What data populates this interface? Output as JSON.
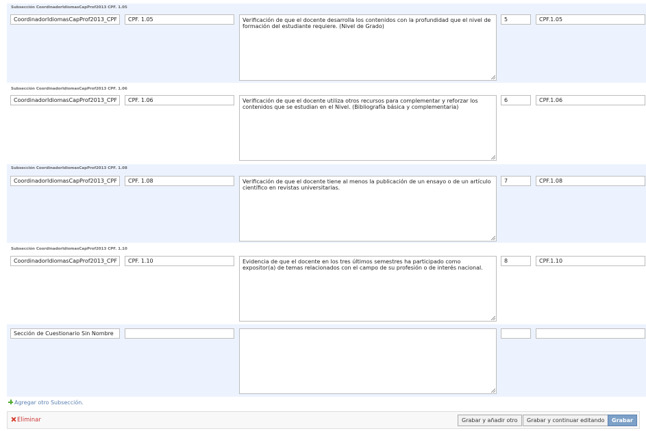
{
  "sections": [
    {
      "title": "Subsección CoordinadorIdiomasCapProf2013  CPF. 1.05",
      "name": "CoordinadorIdiomasCapProf2013_CPF",
      "code": "CPF. 1.05",
      "description": "Verificación de que el docente desarrolla los contenidos con la profundidad que el nivel de formación del estudiante requiere. (Nivel de Grado)",
      "order": "5",
      "identifier": "CPF.1.05"
    },
    {
      "title": "Subsección CoordinadorIdiomasCapProf2013  CPF. 1.06",
      "name": "CoordinadorIdiomasCapProf2013_CPF",
      "code": "CPF. 1.06",
      "description": "Verificación de que el docente utiliza otros recursos para complementar y reforzar los contenidos que se estudian en el Nivel. (Bibliografía básica y complementaria)",
      "order": "6",
      "identifier": "CPF.1.06"
    },
    {
      "title": "Subsección CoordinadorIdiomasCapProf2013  CPF. 1.08",
      "name": "CoordinadorIdiomasCapProf2013_CPF",
      "code": "CPF. 1.08",
      "description": "Verificación de que el docente tiene al menos la publicación de un ensayo o de un artículo científico en revistas universitarias.",
      "order": "7",
      "identifier": "CPF.1.08"
    },
    {
      "title": "Subsección CoordinadorIdiomasCapProf2013  CPF. 1.10",
      "name": "CoordinadorIdiomasCapProf2013_CPF",
      "code": "CPF. 1.10",
      "description": "Evidencia de que el docente en los tres últimos semestres ha participado como expositor(a) de temas relacionados con el campo de su profesión o de interés nacional.",
      "order": "8",
      "identifier": "CPF.1.10"
    },
    {
      "title": "",
      "name": "Sección de Cuestionario Sin Nombre",
      "code": "",
      "description": "",
      "order": "",
      "identifier": ""
    }
  ],
  "add_link": "Agregar otro Subsección.",
  "submit": {
    "delete": "Eliminar",
    "save_add": "Grabar y añadir otro",
    "save_continue": "Grabar y continuar editando",
    "save": "Grabar"
  },
  "colors": {
    "row_alt": "#edf3fe",
    "link": "#5b80b2",
    "delete": "#cc3434",
    "primary_button": "#7ca0c7"
  }
}
